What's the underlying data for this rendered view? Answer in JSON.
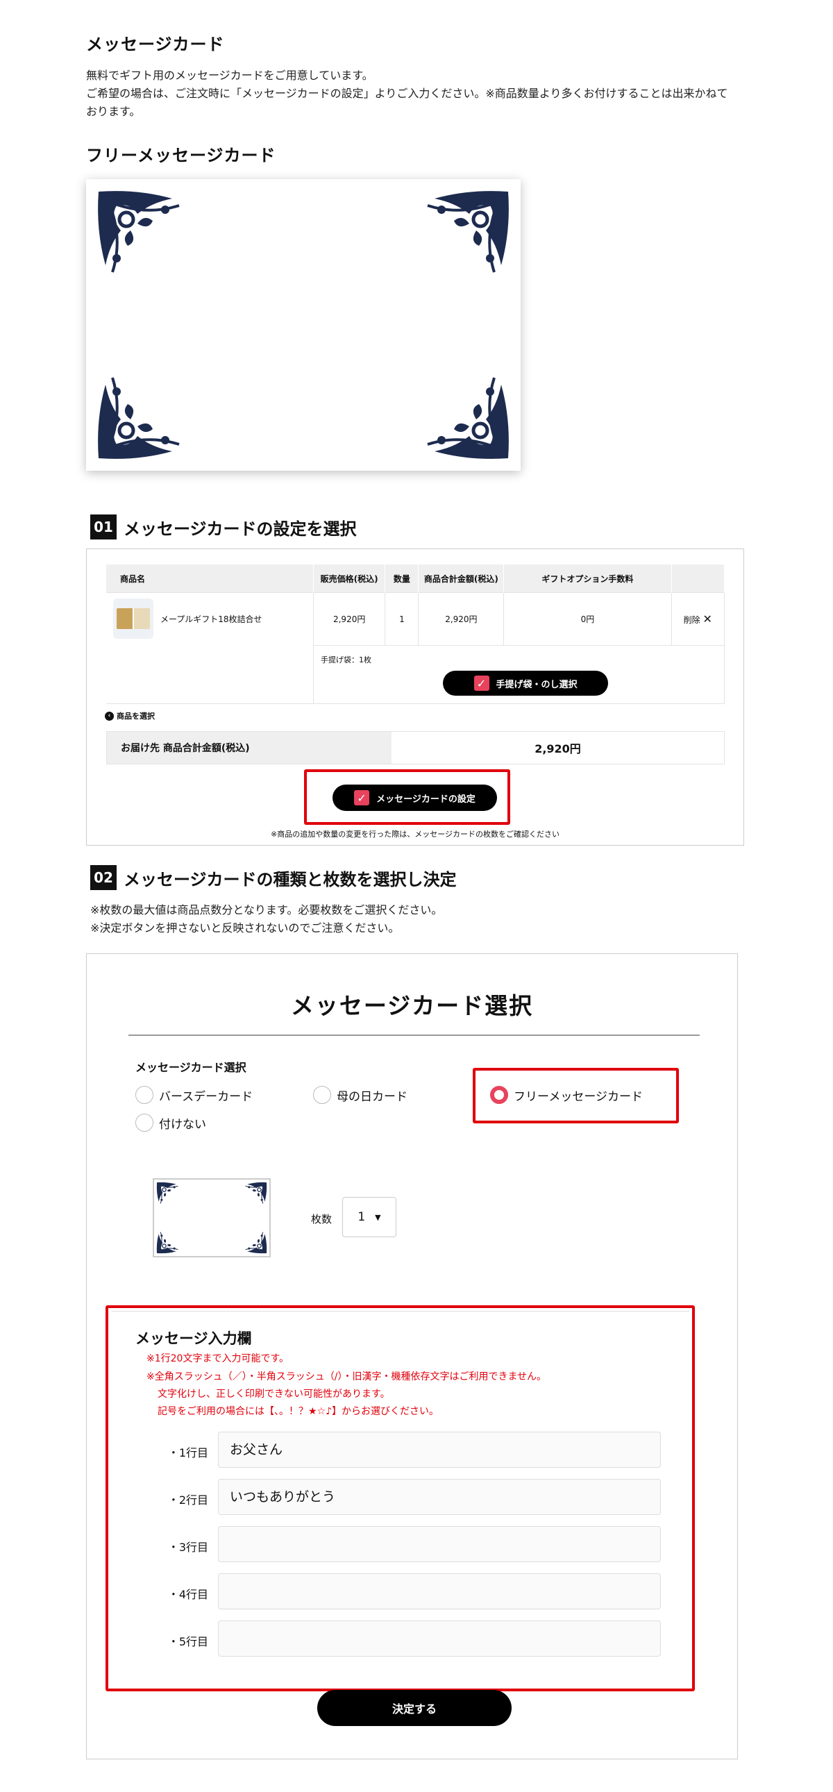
{
  "section": {
    "title": "メッセージカード",
    "desc1": "無料でギフト用のメッセージカードをご用意しています。",
    "desc2": "ご希望の場合は、ご注文時に「メッセージカードの設定」よりご入力ください。※商品数量より多くお付けすることは出来かねて",
    "desc3": "おります。",
    "free_title": "フリーメッセージカード"
  },
  "step1": {
    "num": "01",
    "title": "メッセージカードの設定を選択",
    "headers": [
      "商品名",
      "販売価格(税込)",
      "数量",
      "商品合計金額(税込)",
      "ギフトオプション手数料",
      ""
    ],
    "item": {
      "name": "メープルギフト18枚詰合せ",
      "price": "2,920円",
      "qty": "1",
      "subtotal": "2,920円",
      "fee": "0円",
      "delete": "削除"
    },
    "bag_note": "手提げ袋：1枚",
    "bag_button": "手提げ袋・のし選択",
    "select_product": "商品を選択",
    "total_label": "お届け先 商品合計金額(税込)",
    "total_value": "2,920円",
    "card_button": "メッセージカードの設定",
    "footnote": "※商品の追加や数量の変更を行った際は、メッセージカードの枚数をご確認ください"
  },
  "step2": {
    "num": "02",
    "title": "メッセージカードの種類と枚数を選択し決定",
    "note1": "※枚数の最大値は商品点数分となります。必要枚数をご選択ください。",
    "note2": "※決定ボタンを押さないと反映されないのでご注意ください。",
    "panel_title": "メッセージカード選択",
    "select_label": "メッセージカード選択",
    "options": [
      "バースデーカード",
      "母の日カード",
      "フリーメッセージカード",
      "付けない"
    ],
    "selected": "フリーメッセージカード",
    "count_label": "枚数",
    "count_value": "1",
    "input_title": "メッセージ入力欄",
    "rules": [
      "※1行20文字まで入力可能です。",
      "※全角スラッシュ（／）・半角スラッシュ（/）・旧漢字・機種依存文字はご利用できません。",
      "文字化けし、正しく印刷できない可能性があります。",
      "記号をご利用の場合には【、。！？★☆♪】からお選びください。"
    ],
    "lines": [
      {
        "label": "・1行目",
        "value": "お父さん"
      },
      {
        "label": "・2行目",
        "value": "いつもありがとう"
      },
      {
        "label": "・3行目",
        "value": ""
      },
      {
        "label": "・4行目",
        "value": ""
      },
      {
        "label": "・5行目",
        "value": ""
      }
    ],
    "submit": "決定する"
  },
  "colors": {
    "accent": "#e8425c",
    "highlight": "#e0000b",
    "ornament": "#1d2b4f"
  }
}
